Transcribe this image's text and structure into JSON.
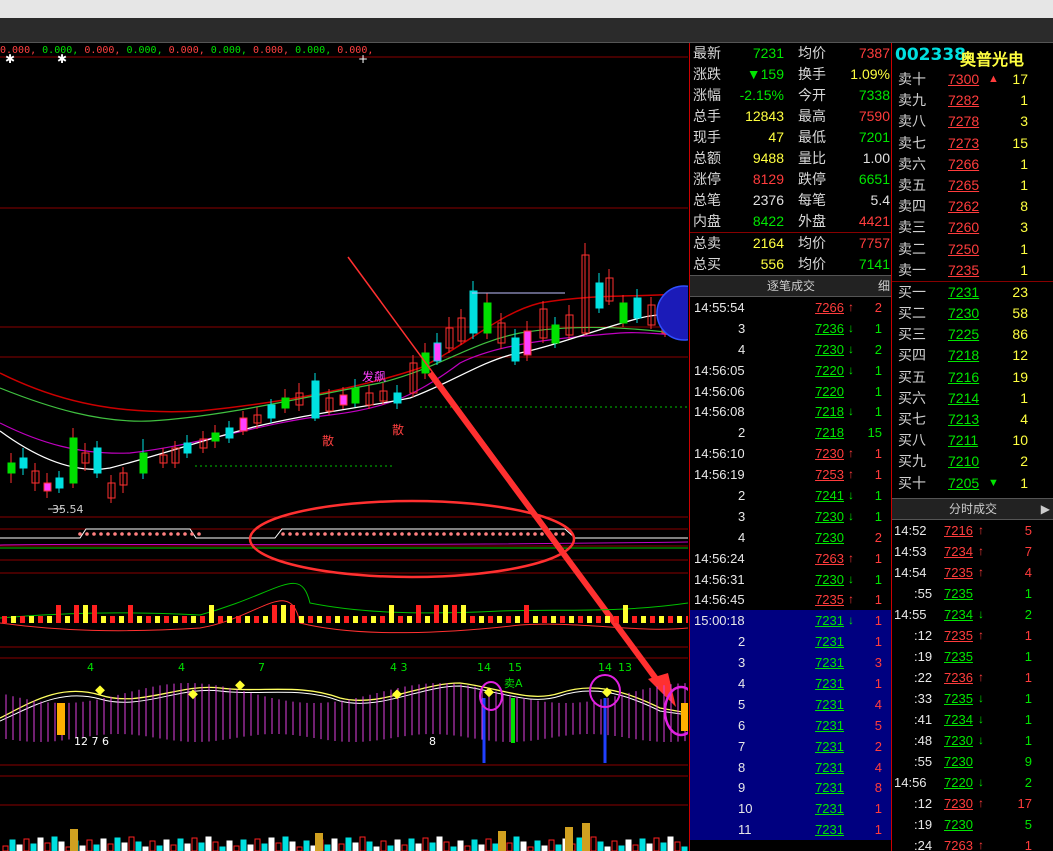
{
  "ma_strip": [
    "0.000,",
    "0.000,",
    "0.000,",
    "0.000,",
    "0.000,",
    "0.000,",
    "0.000,",
    "0.000,",
    "0.000,"
  ],
  "chart_labels": {
    "low_price": "35.54",
    "fa_piao": "发飙",
    "sell_a": "卖A",
    "san1": "散",
    "san2": "散",
    "nums_a": "12  7  6",
    "n4a": "4",
    "n4b": "4",
    "n7": "7",
    "n43": "4 3",
    "n14a": "14",
    "n15": "15",
    "n14b": "14",
    "n13": "13",
    "n8": "8",
    "n3a": "3",
    "n4c": "4"
  },
  "stock": {
    "code": "002338",
    "name": "奥普光电"
  },
  "quote": [
    {
      "l": "最新",
      "v": "7231",
      "c": "grn",
      "l2": "均价",
      "v2": "7387",
      "c2": "red"
    },
    {
      "l": "涨跌",
      "v": "▼159",
      "c": "grn",
      "l2": "换手",
      "v2": "1.09%",
      "c2": "yel"
    },
    {
      "l": "涨幅",
      "v": "-2.15%",
      "c": "grn",
      "l2": "今开",
      "v2": "7338",
      "c2": "grn"
    },
    {
      "l": "总手",
      "v": "12843",
      "c": "yel",
      "l2": "最高",
      "v2": "7590",
      "c2": "red"
    },
    {
      "l": "现手",
      "v": "47",
      "c": "yel",
      "l2": "最低",
      "v2": "7201",
      "c2": "grn"
    },
    {
      "l": "总额",
      "v": "9488",
      "c": "yel",
      "l2": "量比",
      "v2": "1.00",
      "c2": "wht"
    },
    {
      "l": "涨停",
      "v": "8129",
      "c": "red",
      "l2": "跌停",
      "v2": "6651",
      "c2": "grn"
    },
    {
      "l": "总笔",
      "v": "2376",
      "c": "wht",
      "l2": "每笔",
      "v2": "5.4",
      "c2": "wht"
    },
    {
      "l": "内盘",
      "v": "8422",
      "c": "grn",
      "l2": "外盘",
      "v2": "4421",
      "c2": "red"
    },
    {
      "l": "总卖",
      "v": "2164",
      "c": "yel",
      "l2": "均价",
      "v2": "7757",
      "c2": "red"
    },
    {
      "l": "总买",
      "v": "556",
      "c": "yel",
      "l2": "均价",
      "v2": "7141",
      "c2": "grn"
    }
  ],
  "ticks_header": "逐笔成交",
  "ticks_tab": "细",
  "ticks": [
    {
      "t": "14:55:54",
      "p": "7266",
      "a": "↑",
      "c": "red",
      "v": "2",
      "vc": "red"
    },
    {
      "t": "3",
      "p": "7236",
      "a": "↓",
      "c": "grn",
      "v": "1",
      "vc": "grn"
    },
    {
      "t": "4",
      "p": "7230",
      "a": "↓",
      "c": "grn",
      "v": "2",
      "vc": "grn"
    },
    {
      "t": "14:56:05",
      "p": "7220",
      "a": "↓",
      "c": "grn",
      "v": "1",
      "vc": "grn"
    },
    {
      "t": "14:56:06",
      "p": "7220",
      "a": "",
      "c": "grn",
      "v": "1",
      "vc": "grn"
    },
    {
      "t": "14:56:08",
      "p": "7218",
      "a": "↓",
      "c": "grn",
      "v": "1",
      "vc": "grn"
    },
    {
      "t": "2",
      "p": "7218",
      "a": "",
      "c": "grn",
      "v": "15",
      "vc": "grn"
    },
    {
      "t": "14:56:10",
      "p": "7230",
      "a": "↑",
      "c": "red",
      "v": "1",
      "vc": "red"
    },
    {
      "t": "14:56:19",
      "p": "7253",
      "a": "↑",
      "c": "red",
      "v": "1",
      "vc": "red"
    },
    {
      "t": "2",
      "p": "7241",
      "a": "↓",
      "c": "grn",
      "v": "1",
      "vc": "grn"
    },
    {
      "t": "3",
      "p": "7230",
      "a": "↓",
      "c": "grn",
      "v": "1",
      "vc": "grn"
    },
    {
      "t": "4",
      "p": "7230",
      "a": "",
      "c": "grn",
      "v": "2",
      "vc": "red"
    },
    {
      "t": "14:56:24",
      "p": "7263",
      "a": "↑",
      "c": "red",
      "v": "1",
      "vc": "red"
    },
    {
      "t": "14:56:31",
      "p": "7230",
      "a": "↓",
      "c": "grn",
      "v": "1",
      "vc": "grn"
    },
    {
      "t": "14:56:45",
      "p": "7235",
      "a": "↑",
      "c": "red",
      "v": "1",
      "vc": "red"
    }
  ],
  "ticks_blue": [
    {
      "t": "15:00:18",
      "p": "7231",
      "a": "↓",
      "c": "grn",
      "v": "1",
      "vc": "red"
    },
    {
      "t": "2",
      "p": "7231",
      "a": "",
      "c": "grn",
      "v": "1",
      "vc": "red"
    },
    {
      "t": "3",
      "p": "7231",
      "a": "",
      "c": "grn",
      "v": "3",
      "vc": "red"
    },
    {
      "t": "4",
      "p": "7231",
      "a": "",
      "c": "grn",
      "v": "1",
      "vc": "red"
    },
    {
      "t": "5",
      "p": "7231",
      "a": "",
      "c": "grn",
      "v": "4",
      "vc": "red"
    },
    {
      "t": "6",
      "p": "7231",
      "a": "",
      "c": "grn",
      "v": "5",
      "vc": "red"
    },
    {
      "t": "7",
      "p": "7231",
      "a": "",
      "c": "grn",
      "v": "2",
      "vc": "red"
    },
    {
      "t": "8",
      "p": "7231",
      "a": "",
      "c": "grn",
      "v": "4",
      "vc": "red"
    },
    {
      "t": "9",
      "p": "7231",
      "a": "",
      "c": "grn",
      "v": "8",
      "vc": "red"
    },
    {
      "t": "10",
      "p": "7231",
      "a": "",
      "c": "grn",
      "v": "1",
      "vc": "red"
    },
    {
      "t": "11",
      "p": "7231",
      "a": "",
      "c": "grn",
      "v": "1",
      "vc": "red"
    }
  ],
  "sell": [
    {
      "l": "卖十",
      "p": "7300",
      "a": "▲",
      "c": "red",
      "v": "17"
    },
    {
      "l": "卖九",
      "p": "7282",
      "a": "",
      "c": "red",
      "v": "1"
    },
    {
      "l": "卖八",
      "p": "7278",
      "a": "",
      "c": "red",
      "v": "3"
    },
    {
      "l": "卖七",
      "p": "7273",
      "a": "",
      "c": "red",
      "v": "15"
    },
    {
      "l": "卖六",
      "p": "7266",
      "a": "",
      "c": "red",
      "v": "1"
    },
    {
      "l": "卖五",
      "p": "7265",
      "a": "",
      "c": "red",
      "v": "1"
    },
    {
      "l": "卖四",
      "p": "7262",
      "a": "",
      "c": "red",
      "v": "8"
    },
    {
      "l": "卖三",
      "p": "7260",
      "a": "",
      "c": "red",
      "v": "3"
    },
    {
      "l": "卖二",
      "p": "7250",
      "a": "",
      "c": "red",
      "v": "1"
    },
    {
      "l": "卖一",
      "p": "7235",
      "a": "",
      "c": "red",
      "v": "1"
    }
  ],
  "buy": [
    {
      "l": "买一",
      "p": "7231",
      "a": "",
      "c": "grn",
      "v": "23"
    },
    {
      "l": "买二",
      "p": "7230",
      "a": "",
      "c": "grn",
      "v": "58"
    },
    {
      "l": "买三",
      "p": "7225",
      "a": "",
      "c": "grn",
      "v": "86"
    },
    {
      "l": "买四",
      "p": "7218",
      "a": "",
      "c": "grn",
      "v": "12"
    },
    {
      "l": "买五",
      "p": "7216",
      "a": "",
      "c": "grn",
      "v": "19"
    },
    {
      "l": "买六",
      "p": "7214",
      "a": "",
      "c": "grn",
      "v": "1"
    },
    {
      "l": "买七",
      "p": "7213",
      "a": "",
      "c": "grn",
      "v": "4"
    },
    {
      "l": "买八",
      "p": "7211",
      "a": "",
      "c": "grn",
      "v": "10"
    },
    {
      "l": "买九",
      "p": "7210",
      "a": "",
      "c": "grn",
      "v": "2"
    },
    {
      "l": "买十",
      "p": "7205",
      "a": "▼",
      "c": "grn",
      "v": "1"
    }
  ],
  "minute_header": "分时成交",
  "minute": [
    {
      "t": "14:52",
      "p": "7216",
      "a": "↑",
      "c": "red",
      "v": "5",
      "vc": "red"
    },
    {
      "t": "14:53",
      "p": "7234",
      "a": "↑",
      "c": "red",
      "v": "7",
      "vc": "red"
    },
    {
      "t": "14:54",
      "p": "7235",
      "a": "↑",
      "c": "red",
      "v": "4",
      "vc": "red"
    },
    {
      "t": ":55",
      "p": "7235",
      "a": "",
      "c": "grn",
      "v": "1",
      "vc": "grn"
    },
    {
      "t": "14:55",
      "p": "7234",
      "a": "↓",
      "c": "grn",
      "v": "2",
      "vc": "grn"
    },
    {
      "t": ":12",
      "p": "7235",
      "a": "↑",
      "c": "red",
      "v": "1",
      "vc": "red"
    },
    {
      "t": ":19",
      "p": "7235",
      "a": "",
      "c": "grn",
      "v": "1",
      "vc": "grn"
    },
    {
      "t": ":22",
      "p": "7236",
      "a": "↑",
      "c": "red",
      "v": "1",
      "vc": "red"
    },
    {
      "t": ":33",
      "p": "7235",
      "a": "↓",
      "c": "grn",
      "v": "1",
      "vc": "grn"
    },
    {
      "t": ":41",
      "p": "7234",
      "a": "↓",
      "c": "grn",
      "v": "1",
      "vc": "grn"
    },
    {
      "t": ":48",
      "p": "7230",
      "a": "↓",
      "c": "grn",
      "v": "1",
      "vc": "grn"
    },
    {
      "t": ":55",
      "p": "7230",
      "a": "",
      "c": "grn",
      "v": "9",
      "vc": "grn"
    },
    {
      "t": "14:56",
      "p": "7220",
      "a": "↓",
      "c": "grn",
      "v": "2",
      "vc": "grn"
    },
    {
      "t": ":12",
      "p": "7230",
      "a": "↑",
      "c": "red",
      "v": "17",
      "vc": "red"
    },
    {
      "t": ":19",
      "p": "7230",
      "a": "",
      "c": "grn",
      "v": "5",
      "vc": "grn"
    },
    {
      "t": ":24",
      "p": "7263",
      "a": "↑",
      "c": "red",
      "v": "1",
      "vc": "red"
    }
  ]
}
